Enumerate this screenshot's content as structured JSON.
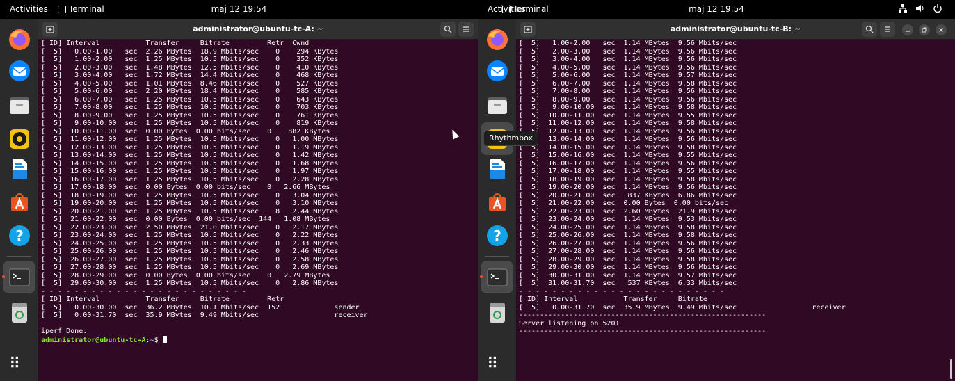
{
  "colors": {
    "terminal_bg": "#300a24",
    "prompt_user": "#8ae234",
    "prompt_path": "#729fcf",
    "dock_active_dot": "#e95420",
    "firefox": "#ff7139",
    "thunderbird": "#0a84ff",
    "rhythmbox": "#f5c211",
    "writer": "#1e88e5",
    "software": "#e95420",
    "help": "#12a4e8"
  },
  "topbar": {
    "activities": "Activities",
    "app_name": "Terminal",
    "clock": "maj 12 19:54"
  },
  "dock": {
    "items": [
      {
        "name": "Firefox",
        "icon": "firefox-icon"
      },
      {
        "name": "Thunderbird",
        "icon": "thunderbird-icon"
      },
      {
        "name": "Files",
        "icon": "files-icon"
      },
      {
        "name": "Rhythmbox",
        "icon": "rhythmbox-icon"
      },
      {
        "name": "LibreOffice Writer",
        "icon": "writer-icon"
      },
      {
        "name": "Ubuntu Software",
        "icon": "software-icon"
      },
      {
        "name": "Help",
        "icon": "help-icon"
      },
      {
        "name": "Terminal",
        "icon": "terminal-icon"
      },
      {
        "name": "Trash",
        "icon": "trash-icon"
      }
    ],
    "apps_grid": "⠿"
  },
  "tooltip": "Rhythmbox",
  "windowA": {
    "title": "administrator@ubuntu-tc-A: ~",
    "lines": [
      "[ ID] Interval           Transfer     Bitrate         Retr  Cwnd",
      "[  5]   0.00-1.00   sec  2.26 MBytes  18.9 Mbits/sec    0    294 KBytes",
      "[  5]   1.00-2.00   sec  1.25 MBytes  10.5 Mbits/sec    0    352 KBytes",
      "[  5]   2.00-3.00   sec  1.48 MBytes  12.5 Mbits/sec    0    410 KBytes",
      "[  5]   3.00-4.00   sec  1.72 MBytes  14.4 Mbits/sec    0    468 KBytes",
      "[  5]   4.00-5.00   sec  1.01 MBytes  8.46 Mbits/sec    0    527 KBytes",
      "[  5]   5.00-6.00   sec  2.20 MBytes  18.4 Mbits/sec    0    585 KBytes",
      "[  5]   6.00-7.00   sec  1.25 MBytes  10.5 Mbits/sec    0    643 KBytes",
      "[  5]   7.00-8.00   sec  1.25 MBytes  10.5 Mbits/sec    0    703 KBytes",
      "[  5]   8.00-9.00   sec  1.25 MBytes  10.5 Mbits/sec    0    761 KBytes",
      "[  5]   9.00-10.00  sec  1.25 MBytes  10.5 Mbits/sec    0    819 KBytes",
      "[  5]  10.00-11.00  sec  0.00 Bytes  0.00 bits/sec    0    882 KBytes",
      "[  5]  11.00-12.00  sec  1.25 MBytes  10.5 Mbits/sec    0   1.00 MBytes",
      "[  5]  12.00-13.00  sec  1.25 MBytes  10.5 Mbits/sec    0   1.19 MBytes",
      "[  5]  13.00-14.00  sec  1.25 MBytes  10.5 Mbits/sec    0   1.42 MBytes",
      "[  5]  14.00-15.00  sec  1.25 MBytes  10.5 Mbits/sec    0   1.68 MBytes",
      "[  5]  15.00-16.00  sec  1.25 MBytes  10.5 Mbits/sec    0   1.97 MBytes",
      "[  5]  16.00-17.00  sec  1.25 MBytes  10.5 Mbits/sec    0   2.28 MBytes",
      "[  5]  17.00-18.00  sec  0.00 Bytes  0.00 bits/sec    0   2.66 MBytes",
      "[  5]  18.00-19.00  sec  1.25 MBytes  10.5 Mbits/sec    0   3.04 MBytes",
      "[  5]  19.00-20.00  sec  1.25 MBytes  10.5 Mbits/sec    0   3.10 MBytes",
      "[  5]  20.00-21.00  sec  1.25 MBytes  10.5 Mbits/sec    8   2.44 MBytes",
      "[  5]  21.00-22.00  sec  0.00 Bytes  0.00 bits/sec  144   1.08 MBytes",
      "[  5]  22.00-23.00  sec  2.50 MBytes  21.0 Mbits/sec    0   2.17 MBytes",
      "[  5]  23.00-24.00  sec  1.25 MBytes  10.5 Mbits/sec    0   2.22 MBytes",
      "[  5]  24.00-25.00  sec  1.25 MBytes  10.5 Mbits/sec    0   2.33 MBytes",
      "[  5]  25.00-26.00  sec  1.25 MBytes  10.5 Mbits/sec    0   2.46 MBytes",
      "[  5]  26.00-27.00  sec  1.25 MBytes  10.5 Mbits/sec    0   2.58 MBytes",
      "[  5]  27.00-28.00  sec  1.25 MBytes  10.5 Mbits/sec    0   2.69 MBytes",
      "[  5]  28.00-29.00  sec  0.00 Bytes  0.00 bits/sec    0   2.79 MBytes",
      "[  5]  29.00-30.00  sec  1.25 MBytes  10.5 Mbits/sec    0   2.86 MBytes",
      "- - - - - - - - - - - - - - - - - - - - - - - - -",
      "[ ID] Interval           Transfer     Bitrate         Retr",
      "[  5]   0.00-30.00  sec  36.2 MBytes  10.1 Mbits/sec  152             sender",
      "[  5]   0.00-31.70  sec  35.9 MBytes  9.49 Mbits/sec                  receiver",
      "",
      "iperf Done."
    ],
    "prompt_user": "administrator@ubuntu-tc-A",
    "prompt_colon": ":",
    "prompt_path": "~",
    "prompt_symbol": "$ "
  },
  "windowB": {
    "title": "administrator@ubuntu-tc-B: ~",
    "lines": [
      "[  5]   1.00-2.00   sec  1.14 MBytes  9.56 Mbits/sec",
      "[  5]   2.00-3.00   sec  1.14 MBytes  9.56 Mbits/sec",
      "[  5]   3.00-4.00   sec  1.14 MBytes  9.56 Mbits/sec",
      "[  5]   4.00-5.00   sec  1.14 MBytes  9.56 Mbits/sec",
      "[  5]   5.00-6.00   sec  1.14 MBytes  9.57 Mbits/sec",
      "[  5]   6.00-7.00   sec  1.14 MBytes  9.58 Mbits/sec",
      "[  5]   7.00-8.00   sec  1.14 MBytes  9.56 Mbits/sec",
      "[  5]   8.00-9.00   sec  1.14 MBytes  9.56 Mbits/sec",
      "[  5]   9.00-10.00  sec  1.14 MBytes  9.58 Mbits/sec",
      "[  5]  10.00-11.00  sec  1.14 MBytes  9.55 Mbits/sec",
      "[  5]  11.00-12.00  sec  1.14 MBytes  9.58 Mbits/sec",
      "[  5]  12.00-13.00  sec  1.14 MBytes  9.56 Mbits/sec",
      "[  5]  13.00-14.00  sec  1.14 MBytes  9.56 Mbits/sec",
      "[  5]  14.00-15.00  sec  1.14 MBytes  9.58 Mbits/sec",
      "[  5]  15.00-16.00  sec  1.14 MBytes  9.55 Mbits/sec",
      "[  5]  16.00-17.00  sec  1.14 MBytes  9.56 Mbits/sec",
      "[  5]  17.00-18.00  sec  1.14 MBytes  9.55 Mbits/sec",
      "[  5]  18.00-19.00  sec  1.14 MBytes  9.58 Mbits/sec",
      "[  5]  19.00-20.00  sec  1.14 MBytes  9.56 Mbits/sec",
      "[  5]  20.00-21.00  sec   837 KBytes  6.86 Mbits/sec",
      "[  5]  21.00-22.00  sec  0.00 Bytes  0.00 bits/sec",
      "[  5]  22.00-23.00  sec  2.60 MBytes  21.9 Mbits/sec",
      "[  5]  23.00-24.00  sec  1.14 MBytes  9.53 Mbits/sec",
      "[  5]  24.00-25.00  sec  1.14 MBytes  9.58 Mbits/sec",
      "[  5]  25.00-26.00  sec  1.14 MBytes  9.58 Mbits/sec",
      "[  5]  26.00-27.00  sec  1.14 MBytes  9.56 Mbits/sec",
      "[  5]  27.00-28.00  sec  1.14 MBytes  9.56 Mbits/sec",
      "[  5]  28.00-29.00  sec  1.14 MBytes  9.58 Mbits/sec",
      "[  5]  29.00-30.00  sec  1.14 MBytes  9.56 Mbits/sec",
      "[  5]  30.00-31.00  sec  1.14 MBytes  9.57 Mbits/sec",
      "[  5]  31.00-31.70  sec   537 KBytes  6.33 Mbits/sec",
      "- - - - - - - - - - - - - - - - - - - - - - - - -",
      "[ ID] Interval           Transfer     Bitrate",
      "[  5]   0.00-31.70  sec  35.9 MBytes  9.49 Mbits/sec                  receiver",
      "-----------------------------------------------------------",
      "Server listening on 5201",
      "-----------------------------------------------------------"
    ]
  }
}
